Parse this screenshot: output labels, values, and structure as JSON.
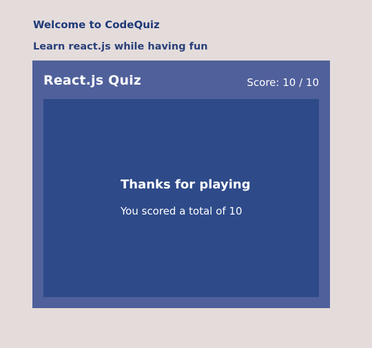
{
  "header": {
    "welcome": "Welcome to CodeQuiz",
    "tagline": "Learn react.js while having fun"
  },
  "quiz": {
    "title": "React.js Quiz",
    "score_text": "Score: 10 / 10",
    "score": 10,
    "total": 10
  },
  "result": {
    "title": "Thanks for playing",
    "message": "You scored a total of 10"
  },
  "colors": {
    "page_background": "#e4dcdb",
    "heading_text": "#1f3a78",
    "card_background": "#50609b",
    "panel_background": "#2e4a89",
    "card_text": "#ffffff"
  }
}
